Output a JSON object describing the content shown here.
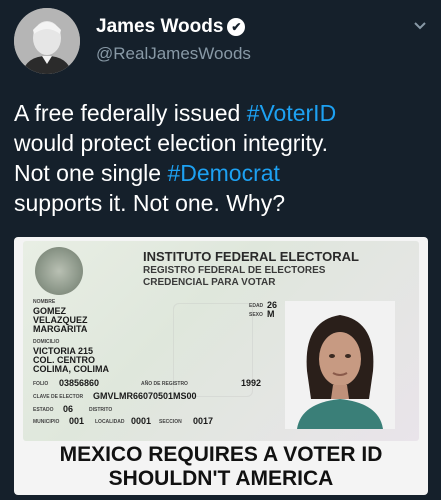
{
  "tweet": {
    "author_name": "James Woods",
    "handle": "@RealJamesWoods",
    "verified_icon": "✔",
    "menu_icon": "chevron-down",
    "text_lines": [
      [
        "A free federally issued ",
        "#VoterID"
      ],
      [
        "would protect election integrity.",
        ""
      ],
      [
        "Not one single ",
        "#Democrat"
      ],
      [
        "supports it. Not one. Why?",
        ""
      ]
    ]
  },
  "id_card": {
    "title": "INSTITUTO FEDERAL ELECTORAL",
    "subtitle1": "REGISTRO FEDERAL DE ELECTORES",
    "subtitle2": "CREDENCIAL PARA VOTAR",
    "labels": {
      "nombre": "NOMBRE",
      "domicilio": "DOMICILIO",
      "folio": "FOLIO",
      "anio_registro": "AÑO DE REGISTRO",
      "clave": "CLAVE DE ELECTOR",
      "estado": "ESTADO",
      "distrito": "DISTRITO",
      "municipio": "MUNICIPIO",
      "localidad": "LOCALIDAD",
      "seccion": "SECCION",
      "edad": "EDAD",
      "sexo": "SEXO"
    },
    "name_lines": [
      "GOMEZ",
      "VELAZQUEZ",
      "MARGARITA"
    ],
    "address_lines": [
      "VICTORIA 215",
      "COL. CENTRO",
      "COLIMA, COLIMA"
    ],
    "folio": "03856860",
    "anio_registro": "1992",
    "clave": "GMVLMR66070501MS00",
    "estado": "06",
    "municipio": "001",
    "localidad": "0001",
    "seccion": "0017",
    "edad": "26",
    "sexo": "M"
  },
  "caption": {
    "line1": "MEXICO REQUIRES A VOTER ID",
    "line2": "SHOULDN'T AMERICA"
  },
  "colors": {
    "background": "#15202b",
    "hashtag": "#1da1f2",
    "handle": "#8899a6"
  }
}
